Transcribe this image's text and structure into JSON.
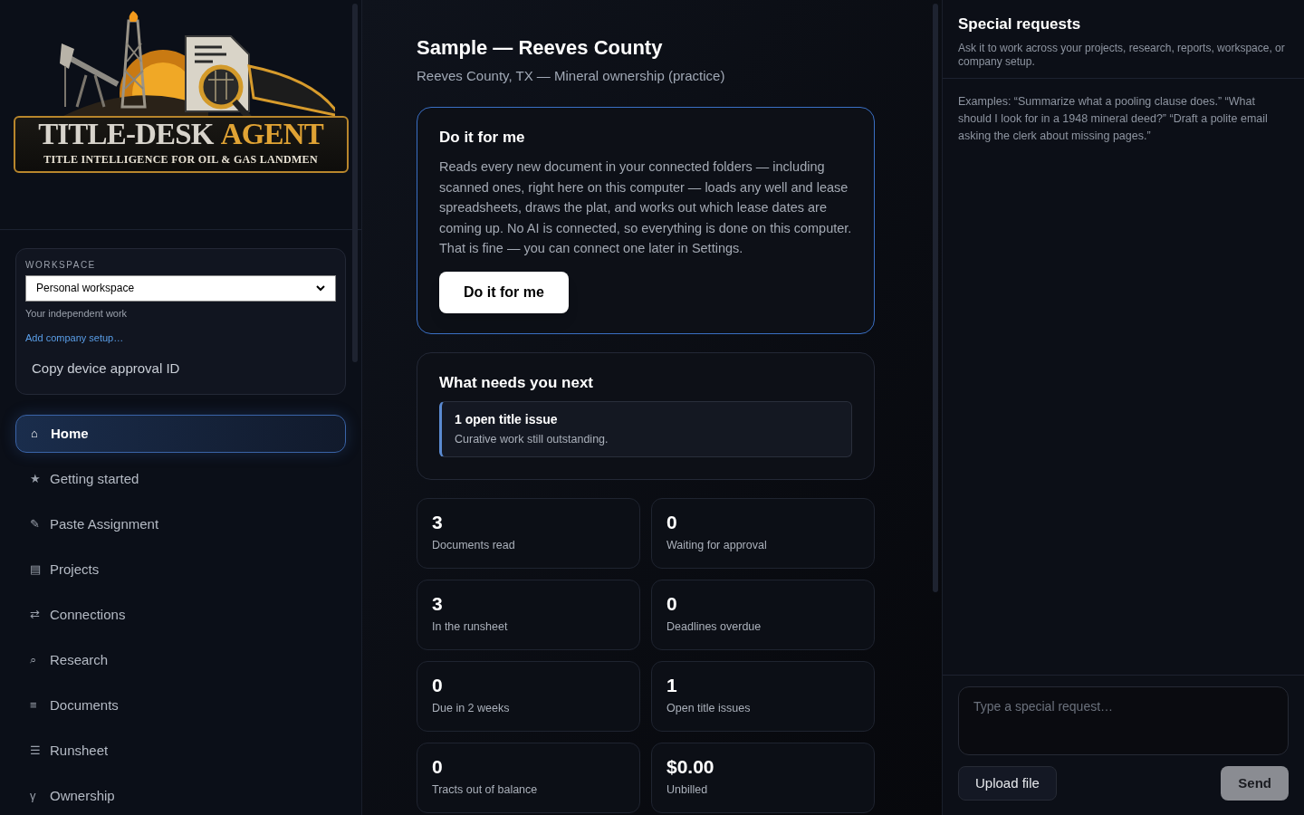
{
  "logo": {
    "title_part_1": "TITLE-DESK",
    "title_part_2": "AGENT",
    "tagline": "TITLE INTELLIGENCE FOR OIL & GAS LANDMEN"
  },
  "workspace": {
    "label": "WORKSPACE",
    "selected_option": "Personal workspace",
    "note": "Your independent work",
    "link": "Add company setup…",
    "copy_button": "Copy device approval ID"
  },
  "nav": [
    {
      "icon": "⌂",
      "label": "Home",
      "selected": true
    },
    {
      "icon": "★",
      "label": "Getting started",
      "selected": false
    },
    {
      "icon": "✎",
      "label": "Paste Assignment",
      "selected": false
    },
    {
      "icon": "▤",
      "label": "Projects",
      "selected": false
    },
    {
      "icon": "⇄",
      "label": "Connections",
      "selected": false
    },
    {
      "icon": "⌕",
      "label": "Research",
      "selected": false
    },
    {
      "icon": "≡",
      "label": "Documents",
      "selected": false
    },
    {
      "icon": "☰",
      "label": "Runsheet",
      "selected": false
    },
    {
      "icon": "γ",
      "label": "Ownership",
      "selected": false
    }
  ],
  "header": {
    "title": "Sample — Reeves County",
    "subtitle": "Reeves County, TX — Mineral ownership (practice)"
  },
  "autopilot": {
    "title": "Do it for me",
    "text": "Reads every new document in your connected folders — including scanned ones, right here on this computer — loads any well and lease spreadsheets, draws the plat, and works out which lease dates are coming up. No AI is connected, so everything is done on this computer. That is fine — you can connect one later in Settings.",
    "button": "Do it for me"
  },
  "next": {
    "title": "What needs you next",
    "items": [
      {
        "title": "1 open title issue",
        "detail": "Curative work still outstanding."
      }
    ]
  },
  "stats": [
    {
      "value": "3",
      "label": "Documents read"
    },
    {
      "value": "0",
      "label": "Waiting for approval"
    },
    {
      "value": "3",
      "label": "In the runsheet"
    },
    {
      "value": "0",
      "label": "Deadlines overdue"
    },
    {
      "value": "0",
      "label": "Due in 2 weeks"
    },
    {
      "value": "1",
      "label": "Open title issues"
    },
    {
      "value": "0",
      "label": "Tracts out of balance"
    },
    {
      "value": "$0.00",
      "label": "Unbilled"
    }
  ],
  "requests": {
    "title": "Special requests",
    "subtitle": "Ask it to work across your projects, research, reports, workspace, or company setup.",
    "examples": "Examples: “Summarize what a pooling clause does.” “What should I look for in a 1948 mineral deed?” “Draft a polite email asking the clerk about missing pages.”",
    "placeholder": "Type a special request…",
    "upload_button": "Upload file",
    "send_button": "Send",
    "send_disabled": true
  }
}
